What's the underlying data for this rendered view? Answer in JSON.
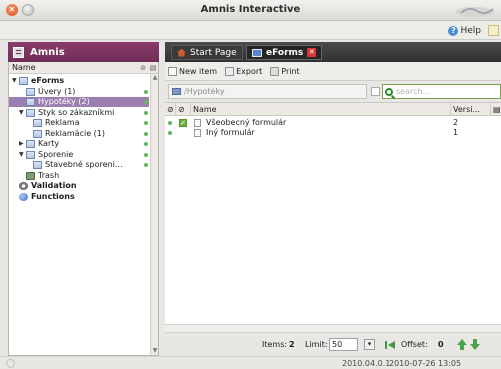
{
  "window": {
    "title": "Amnis Interactive"
  },
  "helpbar": {
    "help_label": "Help"
  },
  "left": {
    "header_title": "Amnis",
    "column_name": "Name",
    "tree": [
      {
        "label": "eForms",
        "level": 0,
        "expanded": true,
        "bold": true,
        "icon": "folder-icon",
        "dot": false,
        "selected": false
      },
      {
        "label": "Úvery (1)",
        "level": 1,
        "expanded": null,
        "bold": false,
        "icon": "folder-icon",
        "dot": true,
        "selected": false
      },
      {
        "label": "Hypotéky (2)",
        "level": 1,
        "expanded": null,
        "bold": false,
        "icon": "folder-icon",
        "dot": true,
        "selected": true
      },
      {
        "label": "Styk so zákazníkmi",
        "level": 1,
        "expanded": true,
        "bold": false,
        "icon": "folder-icon",
        "dot": true,
        "selected": false
      },
      {
        "label": "Reklama",
        "level": 2,
        "expanded": null,
        "bold": false,
        "icon": "folder-icon",
        "dot": true,
        "selected": false
      },
      {
        "label": "Reklamácie (1)",
        "level": 2,
        "expanded": null,
        "bold": false,
        "icon": "folder-icon",
        "dot": true,
        "selected": false
      },
      {
        "label": "Karty",
        "level": 1,
        "expanded": false,
        "bold": false,
        "icon": "folder-icon",
        "dot": true,
        "selected": false
      },
      {
        "label": "Sporenie",
        "level": 1,
        "expanded": true,
        "bold": false,
        "icon": "folder-icon",
        "dot": true,
        "selected": false
      },
      {
        "label": "Stavebné sporeni...",
        "level": 2,
        "expanded": null,
        "bold": false,
        "icon": "folder-icon",
        "dot": true,
        "selected": false
      },
      {
        "label": "Trash",
        "level": 1,
        "expanded": null,
        "bold": false,
        "icon": "trash-icon",
        "dot": false,
        "selected": false
      },
      {
        "label": "Validation",
        "level": 0,
        "expanded": null,
        "bold": true,
        "icon": "gear-icon",
        "dot": false,
        "selected": false
      },
      {
        "label": "Functions",
        "level": 0,
        "expanded": null,
        "bold": true,
        "icon": "bullet-icon",
        "dot": false,
        "selected": false
      }
    ]
  },
  "tabs": [
    {
      "label": "Start Page",
      "active": false
    },
    {
      "label": "eForms",
      "active": true
    }
  ],
  "toolbar": {
    "new_label": "New item",
    "export_label": "Export",
    "print_label": "Print"
  },
  "pathbar": {
    "path_value": "/Hypotéky",
    "search_placeholder": "search..."
  },
  "grid": {
    "columns": {
      "name": "Name",
      "version": "Versi..."
    },
    "rows": [
      {
        "name": "Všeobecný formulár",
        "version": "2",
        "checked": true
      },
      {
        "name": "Iný formulár",
        "version": "1",
        "checked": false
      }
    ]
  },
  "pager": {
    "items_label": "Items:",
    "items_value": "2",
    "limit_label": "Limit:",
    "limit_value": "50",
    "offset_label": "Offset:",
    "offset_value": "0"
  },
  "status": {
    "version": "2010.04.0.1",
    "datetime": "2010-07-26 13:05"
  },
  "colors": {
    "accent": "#7a3360",
    "selection": "#9b7fb1",
    "status_dot": "#5fb85f"
  }
}
